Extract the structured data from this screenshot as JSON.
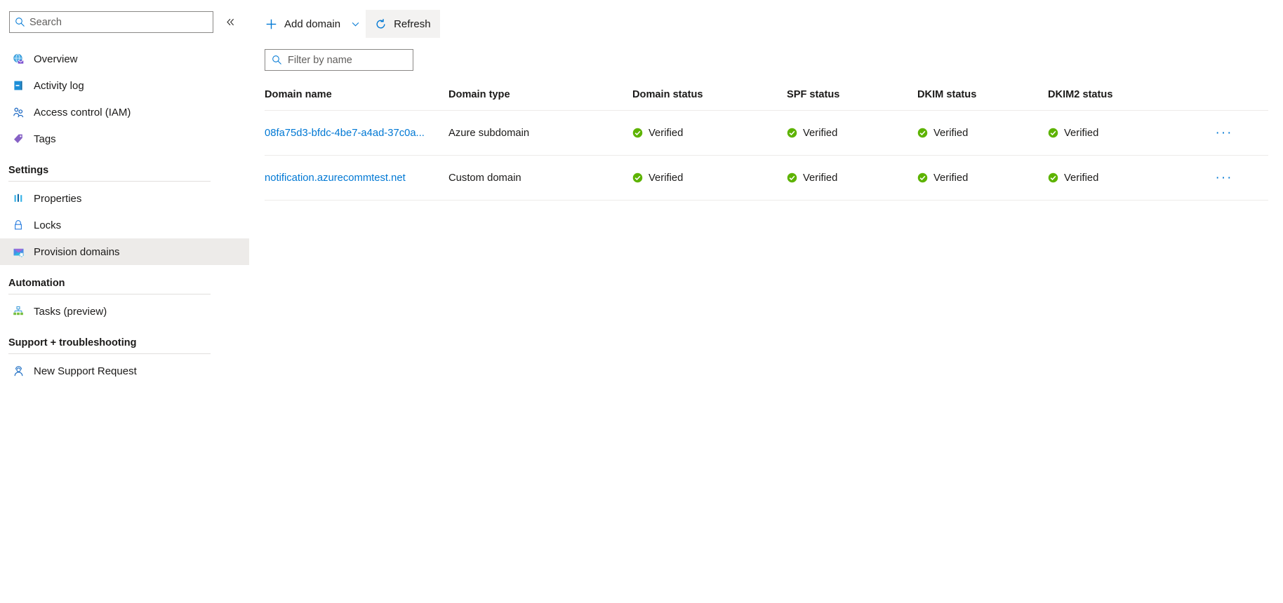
{
  "sidebar": {
    "search": {
      "placeholder": "Search",
      "value": "",
      "icon": "search-icon"
    },
    "collapse_icon": "collapse-chevrons-icon",
    "top_items": [
      {
        "label": "Overview",
        "icon": "overview-email-globe-icon"
      },
      {
        "label": "Activity log",
        "icon": "activity-log-icon"
      },
      {
        "label": "Access control (IAM)",
        "icon": "access-control-people-icon"
      },
      {
        "label": "Tags",
        "icon": "tags-icon"
      }
    ],
    "groups": [
      {
        "title": "Settings",
        "items": [
          {
            "label": "Properties",
            "icon": "properties-bars-icon",
            "selected": false
          },
          {
            "label": "Locks",
            "icon": "lock-icon",
            "selected": false
          },
          {
            "label": "Provision domains",
            "icon": "provision-domains-envelope-icon",
            "selected": true
          }
        ]
      },
      {
        "title": "Automation",
        "items": [
          {
            "label": "Tasks (preview)",
            "icon": "tasks-hierarchy-icon",
            "selected": false
          }
        ]
      },
      {
        "title": "Support + troubleshooting",
        "items": [
          {
            "label": "New Support Request",
            "icon": "support-person-icon",
            "selected": false
          }
        ]
      }
    ]
  },
  "toolbar": {
    "add_domain_label": "Add domain",
    "add_domain_icon": "plus-icon",
    "add_domain_caret_icon": "chevron-down-icon",
    "refresh_label": "Refresh",
    "refresh_icon": "refresh-icon",
    "refresh_active": true
  },
  "filter": {
    "placeholder": "Filter by name",
    "value": "",
    "icon": "search-icon"
  },
  "table": {
    "columns": [
      "Domain name",
      "Domain type",
      "Domain status",
      "SPF status",
      "DKIM status",
      "DKIM2 status"
    ],
    "row_menu_label": "···",
    "rows": [
      {
        "name": "08fa75d3-bfdc-4be7-a4ad-37c0a...",
        "type": "Azure subdomain",
        "domain_status": "Verified",
        "spf_status": "Verified",
        "dkim_status": "Verified",
        "dkim2_status": "Verified"
      },
      {
        "name": "notification.azurecommtest.net",
        "type": "Custom domain",
        "domain_status": "Verified",
        "spf_status": "Verified",
        "dkim_status": "Verified",
        "dkim2_status": "Verified"
      }
    ]
  },
  "colors": {
    "accent": "#0078d4",
    "verified_green": "#5db300",
    "selected_nav": "#edebe9",
    "border": "#edebe9"
  }
}
